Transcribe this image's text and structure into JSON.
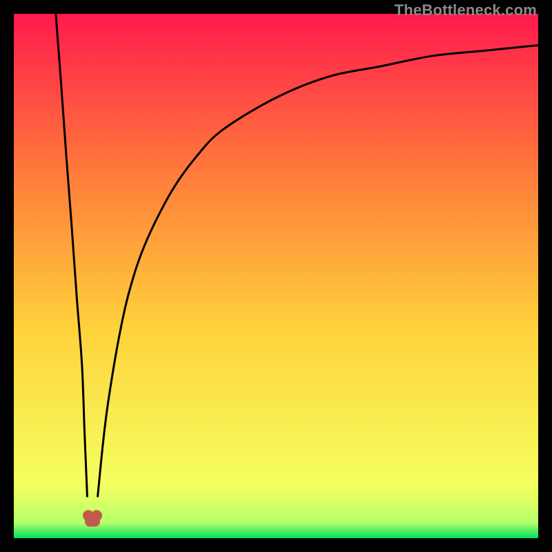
{
  "watermark": "TheBottleneck.com",
  "chart_data": {
    "type": "line",
    "title": "",
    "xlabel": "",
    "ylabel": "",
    "xlim": [
      0,
      100
    ],
    "ylim": [
      0,
      100
    ],
    "minimum_x": 15,
    "grid": false,
    "legend": null,
    "background_gradient": [
      {
        "y": 0,
        "color": "#00e060"
      },
      {
        "y": 3,
        "color": "#b6ff6a"
      },
      {
        "y": 10,
        "color": "#f4ff60"
      },
      {
        "y": 40,
        "color": "#ffd23c"
      },
      {
        "y": 70,
        "color": "#ff7a3a"
      },
      {
        "y": 100,
        "color": "#ff1a4e"
      }
    ],
    "series": [
      {
        "name": "left-branch",
        "x": [
          8,
          9,
          10,
          11,
          12,
          13,
          13.5,
          14
        ],
        "values": [
          100,
          87,
          73,
          60,
          46,
          33,
          20,
          8
        ]
      },
      {
        "name": "right-branch",
        "x": [
          16,
          17,
          18,
          20,
          22,
          25,
          30,
          35,
          40,
          50,
          60,
          70,
          80,
          90,
          100
        ],
        "values": [
          8,
          18,
          26,
          38,
          47,
          56,
          66,
          73,
          78,
          84,
          88,
          90,
          92,
          93,
          94
        ]
      }
    ],
    "marker": {
      "name": "minimum-marker",
      "x": 15,
      "y": 3,
      "color": "#c05a4a"
    }
  }
}
